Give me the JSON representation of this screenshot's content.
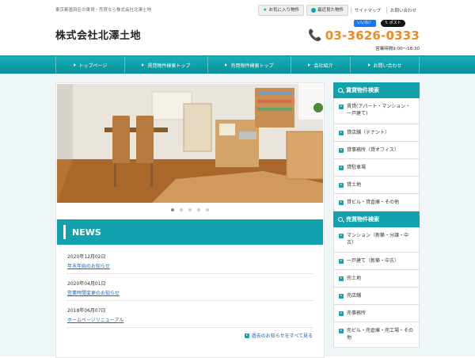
{
  "header": {
    "tagline": "東京都墨田区の賃貸・売買なら株式会社北澤土地",
    "favorites_label": "お気に入り物件",
    "recent_label": "最近見た物件",
    "sitemap_label": "サイトマップ",
    "contact_label": "お問い合わせ",
    "logo": "株式会社北澤土地",
    "like_label": "いいね！",
    "tweet_label": "ポスト",
    "phone": "03-3626-0333",
    "hours": "営業時間9:00～18:30"
  },
  "nav": {
    "items": [
      "トップページ",
      "賃貸物件検索トップ",
      "売買物件検索トップ",
      "会社紹介",
      "お問い合わせ"
    ]
  },
  "slider": {
    "active_index": 0,
    "count": 5
  },
  "news": {
    "title": "NEWS",
    "items": [
      {
        "date": "2020年12月02日",
        "title": "年末年始のお知らせ"
      },
      {
        "date": "2020年04月01日",
        "title": "営業時間変更のお知らせ"
      },
      {
        "date": "2018年06月07日",
        "title": "ホームページリニューアル"
      }
    ],
    "more_label": "過去のお知らせをすべて見る"
  },
  "sidebar": {
    "rent_title": "賃貸物件検索",
    "rent_items": [
      "賃貸(アパート・マンション・一戸建て)",
      "貸店舗（テナント）",
      "貸事務所（貸オフィス）",
      "貸駐車場",
      "貸土地",
      "貸ビル・貸倉庫・その他"
    ],
    "sale_title": "売買物件検索",
    "sale_items": [
      "マンション（新築・分譲・中古）",
      "一戸建て（新築・中古）",
      "売土地",
      "売店舗",
      "売事務所",
      "売ビル・売倉庫・売工場・その他"
    ]
  },
  "colors": {
    "accent": "#12a2ad",
    "phone": "#f08a1f",
    "link": "#1565c0"
  }
}
